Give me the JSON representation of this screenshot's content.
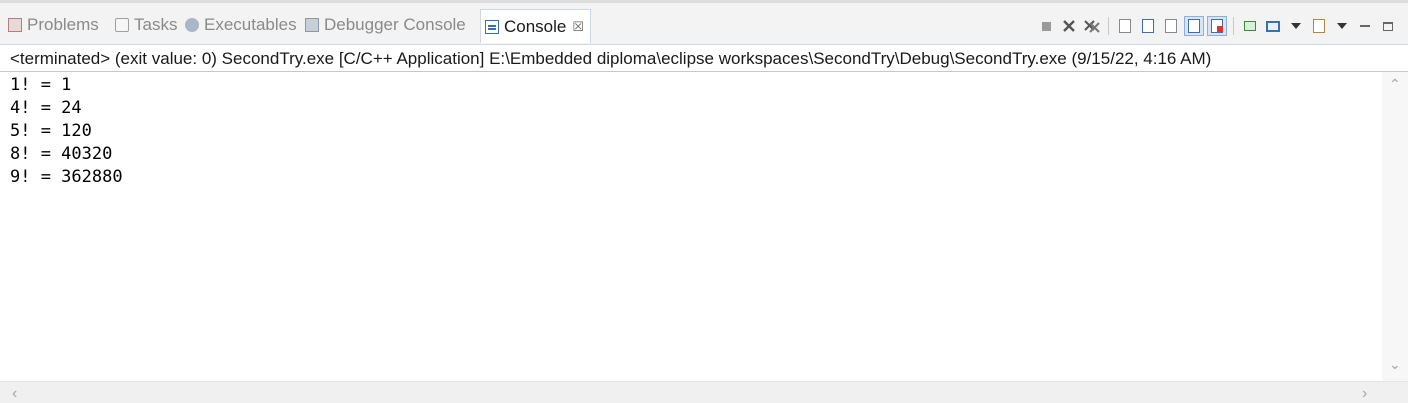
{
  "tabs": [
    {
      "label": "Problems",
      "icon": "problems-icon",
      "active": false
    },
    {
      "label": "Tasks",
      "icon": "tasks-icon",
      "active": false
    },
    {
      "label": "Executables",
      "icon": "executables-icon",
      "active": false
    },
    {
      "label": "Debugger Console",
      "icon": "debugger-console-icon",
      "active": false
    },
    {
      "label": "Console",
      "icon": "console-icon",
      "active": true,
      "close_glyph": "☒"
    }
  ],
  "toolbar": {
    "icons": [
      "terminate-icon",
      "remove-launch-icon",
      "remove-all-launches-icon",
      "clear-console-icon",
      "scroll-lock-icon",
      "word-wrap-icon",
      "show-on-stdout-icon",
      "show-on-stderr-icon",
      "pin-console-icon",
      "display-console-icon",
      "new-console-icon",
      "minimize-icon",
      "maximize-icon"
    ]
  },
  "status": {
    "text": "<terminated> (exit value: 0) SecondTry.exe [C/C++ Application] E:\\Embedded diploma\\eclipse workspaces\\SecondTry\\Debug\\SecondTry.exe (9/15/22, 4:16 AM)"
  },
  "console": {
    "lines": [
      "1! = 1",
      "4! = 24",
      "5! = 120",
      "8! = 40320",
      "9! = 362880"
    ]
  },
  "scrollbars": {
    "up": "⌃",
    "down": "⌄",
    "left": "‹",
    "right": "›"
  },
  "colors": {
    "accent": "#3c6fb0",
    "tab_inactive_text": "#8a8a8a",
    "background": "#f3f3f3"
  }
}
